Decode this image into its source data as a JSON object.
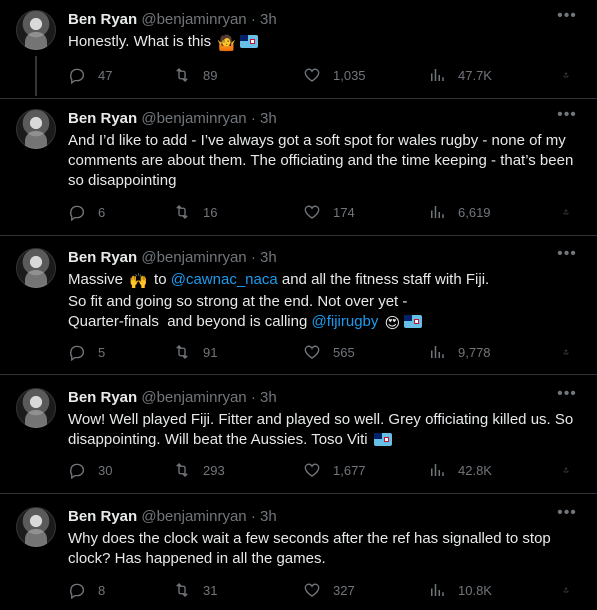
{
  "tweets": [
    {
      "author_name": "Ben Ryan",
      "handle": "@benjaminryan",
      "separator": "·",
      "time": "3h",
      "text_parts": [
        "Honestly. What is this "
      ],
      "emojis": [
        "person-shrugging",
        "fiji-flag"
      ],
      "replies": "47",
      "retweets": "89",
      "likes": "1,035",
      "views": "47.7K"
    },
    {
      "author_name": "Ben Ryan",
      "handle": "@benjaminryan",
      "separator": "·",
      "time": "3h",
      "text_parts": [
        "And I’d like to add - I’ve always got a soft spot for wales rugby - none of my comments are about them. The officiating and the time keeping - that’s been so disappointing"
      ],
      "replies": "6",
      "retweets": "16",
      "likes": "174",
      "views": "6,619"
    },
    {
      "author_name": "Ben Ryan",
      "handle": "@benjaminryan",
      "separator": "·",
      "time": "3h",
      "text_parts": [
        "Massive ",
        " to ",
        "@cawnac_naca",
        " and all the fitness staff with Fiji.\nSo fit and going so strong at the end. Not over yet -\nQuarter-finals  and beyond is calling ",
        "@fijirugby",
        " "
      ],
      "emojis": [
        "raising-hands",
        "heart-eyes-face",
        "fiji-flag"
      ],
      "replies": "5",
      "retweets": "91",
      "likes": "565",
      "views": "9,778"
    },
    {
      "author_name": "Ben Ryan",
      "handle": "@benjaminryan",
      "separator": "·",
      "time": "3h",
      "text_parts": [
        "Wow! Well played Fiji. Fitter and played so well. Grey officiating killed us. So disappointing. Will beat the Aussies. Toso Viti "
      ],
      "emojis": [
        "fiji-flag"
      ],
      "replies": "30",
      "retweets": "293",
      "likes": "1,677",
      "views": "42.8K"
    },
    {
      "author_name": "Ben Ryan",
      "handle": "@benjaminryan",
      "separator": "·",
      "time": "3h",
      "text_parts": [
        "Why does the clock wait a few seconds after the ref has signalled to stop clock? Has happened in all the games."
      ],
      "replies": "8",
      "retweets": "31",
      "likes": "327",
      "views": "10.8K"
    }
  ],
  "icons": {
    "reply": "reply-icon",
    "retweet": "retweet-icon",
    "like": "heart-icon",
    "views": "views-icon",
    "share": "share-icon",
    "more": "more-icon"
  },
  "colors": {
    "background": "#000000",
    "text": "#e7e9ea",
    "secondary": "#71767b",
    "link": "#1d9bf0",
    "divider": "#2f3336"
  }
}
